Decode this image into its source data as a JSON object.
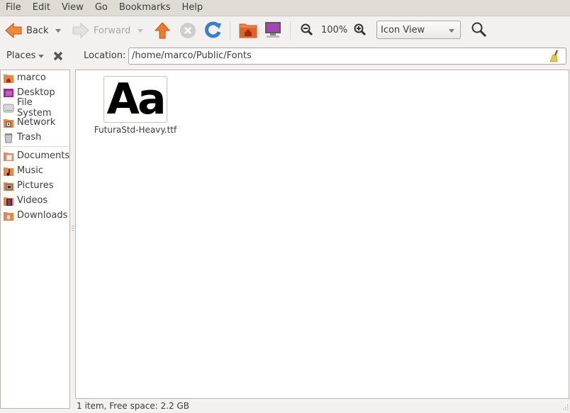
{
  "menu": [
    "File",
    "Edit",
    "View",
    "Go",
    "Bookmarks",
    "Help"
  ],
  "toolbar": {
    "back_label": "Back",
    "forward_label": "Forward",
    "zoom_level": "100%",
    "view_mode": "Icon View"
  },
  "location": {
    "places_label": "Places",
    "label": "Location:",
    "path": "/home/marco/Public/Fonts"
  },
  "sidebar": {
    "items": [
      {
        "label": "marco",
        "icon": "home-folder-icon"
      },
      {
        "label": "Desktop",
        "icon": "desktop-icon"
      },
      {
        "label": "File System",
        "icon": "harddisk-icon"
      },
      {
        "label": "Network",
        "icon": "network-icon"
      },
      {
        "label": "Trash",
        "icon": "trash-icon"
      }
    ],
    "bookmarks": [
      {
        "label": "Documents",
        "icon": "documents-folder-icon"
      },
      {
        "label": "Music",
        "icon": "music-folder-icon"
      },
      {
        "label": "Pictures",
        "icon": "pictures-folder-icon"
      },
      {
        "label": "Videos",
        "icon": "videos-folder-icon"
      },
      {
        "label": "Downloads",
        "icon": "downloads-folder-icon"
      }
    ]
  },
  "files": [
    {
      "name": "FuturaStd-Heavy.ttf",
      "preview": "Aa"
    }
  ],
  "status": "1 item, Free space: 2.2 GB",
  "colors": {
    "accent_orange": "#e5631c",
    "reload_blue": "#3a7fcf",
    "desktop_purple": "#9b2d8f"
  }
}
